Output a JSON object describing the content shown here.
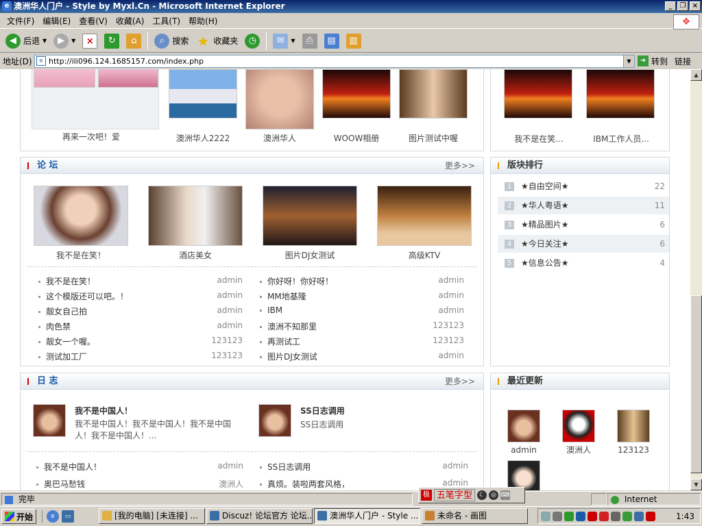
{
  "window": {
    "title": "澳洲华人门户 - Style by Myxl.Cn - Microsoft Internet Explorer"
  },
  "menu": [
    "文件(F)",
    "编辑(E)",
    "查看(V)",
    "收藏(A)",
    "工具(T)",
    "帮助(H)"
  ],
  "toolbar": {
    "back": "后退",
    "search": "搜索",
    "favorites": "收藏夹"
  },
  "address": {
    "label": "地址(D)",
    "url": "http://ili096.124.1685157.com/index.php",
    "go": "转到",
    "links": "链接"
  },
  "top_gallery": {
    "left": [
      "再来一次吧！爱",
      "澳洲华人2222",
      "澳洲华人",
      "WOOW相册",
      "图片测试中喔"
    ],
    "right": [
      "我不是在笑...",
      "IBM工作人员..."
    ]
  },
  "forum": {
    "title": "论 坛",
    "more": "更多>>",
    "photos": [
      "我不是在笑！",
      "酒店美女",
      "图片DJ女测试",
      "高级KTV"
    ],
    "left_posts": [
      {
        "title": "我不是在笑！",
        "author": "admin"
      },
      {
        "title": "这个模版还可以吧。！",
        "author": "admin"
      },
      {
        "title": "靓女自己拍",
        "author": "admin"
      },
      {
        "title": "肉色禁",
        "author": "admin"
      },
      {
        "title": "靓女一个喔。",
        "author": "123123"
      },
      {
        "title": "测试加工厂",
        "author": "123123"
      }
    ],
    "right_posts": [
      {
        "title": "你好呀！你好呀！",
        "author": "admin"
      },
      {
        "title": "MM地基隆",
        "author": "admin"
      },
      {
        "title": "IBM",
        "author": "admin"
      },
      {
        "title": "澳洲不知那里",
        "author": "123123"
      },
      {
        "title": "再测试工",
        "author": "123123"
      },
      {
        "title": "图片DJ女测试",
        "author": "admin"
      }
    ]
  },
  "ranking": {
    "title": "版块排行",
    "items": [
      {
        "num": "1",
        "name": "★自由空间★",
        "count": "22"
      },
      {
        "num": "2",
        "name": "★华人粤语★",
        "count": "11"
      },
      {
        "num": "3",
        "name": "★精品图片★",
        "count": "6"
      },
      {
        "num": "4",
        "name": "★今日关注★",
        "count": "6"
      },
      {
        "num": "5",
        "name": "★信息公告★",
        "count": "4"
      }
    ]
  },
  "blog": {
    "title": "日 志",
    "more": "更多>>",
    "entries": [
      {
        "title": "我不是中国人！",
        "body": "我不是中国人！我不是中国人！我不是中国人！我不是中国人！..."
      },
      {
        "title": "SS日志调用",
        "body": "SS日志调用"
      }
    ],
    "left_posts": [
      {
        "title": "我不是中国人！",
        "author": "admin"
      },
      {
        "title": "奥巴马愁钱",
        "author": "澳洲人"
      }
    ],
    "right_posts": [
      {
        "title": "SS日志调用",
        "author": "admin"
      },
      {
        "title": "真烦。装啦两套风格，",
        "author": "admin"
      }
    ]
  },
  "recent": {
    "title": "最近更新",
    "users": [
      "admin",
      "澳洲人",
      "123123"
    ]
  },
  "status": {
    "text": "完毕",
    "zone": "Internet"
  },
  "ime": {
    "name": "五笔字型"
  },
  "taskbar": {
    "start": "开始",
    "tasks": [
      "[我的电脑] [未连接] ...",
      "Discuz! 论坛官方 论坛...",
      "澳洲华人门户 - Style ...",
      "未命名 - 画图"
    ],
    "clock": "1:43"
  },
  "colors": {
    "title_bar": "#0a246a",
    "section_title": "#1a5aa6",
    "accent_bar": "#cc0000"
  }
}
